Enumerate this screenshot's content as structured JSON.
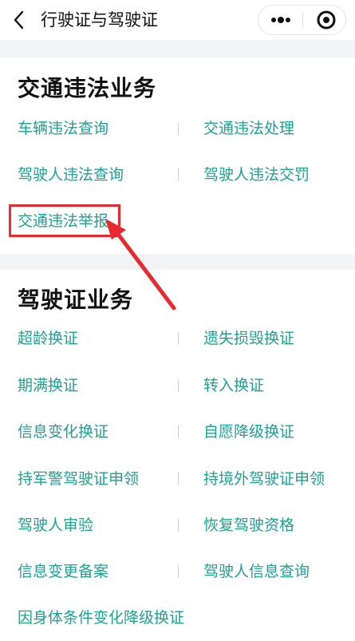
{
  "nav": {
    "title": "行驶证与驾驶证",
    "back_icon": "back-chevron-icon",
    "more_icon": "more-dots-icon",
    "close_icon": "target-close-icon"
  },
  "sections": [
    {
      "title": "交通违法业务",
      "items": [
        {
          "label": "车辆违法查询"
        },
        {
          "label": "交通违法处理"
        },
        {
          "label": "驾驶人违法查询"
        },
        {
          "label": "驾驶人违法交罚"
        },
        {
          "label": "交通违法举报"
        }
      ]
    },
    {
      "title": "驾驶证业务",
      "items": [
        {
          "label": "超龄换证"
        },
        {
          "label": "遗失损毁换证"
        },
        {
          "label": "期满换证"
        },
        {
          "label": "转入换证"
        },
        {
          "label": "信息变化换证"
        },
        {
          "label": "自愿降级换证"
        },
        {
          "label": "持军警驾驶证申领"
        },
        {
          "label": "持境外驾驶证申领"
        },
        {
          "label": "驾驶人审验"
        },
        {
          "label": "恢复驾驶资格"
        },
        {
          "label": "信息变更备案"
        },
        {
          "label": "驾驶人信息查询"
        },
        {
          "label": "因身体条件变化降级换证"
        }
      ]
    }
  ],
  "colors": {
    "link": "#1fa091",
    "highlight": "#e8292e",
    "gap_background": "#f1f3f5"
  }
}
